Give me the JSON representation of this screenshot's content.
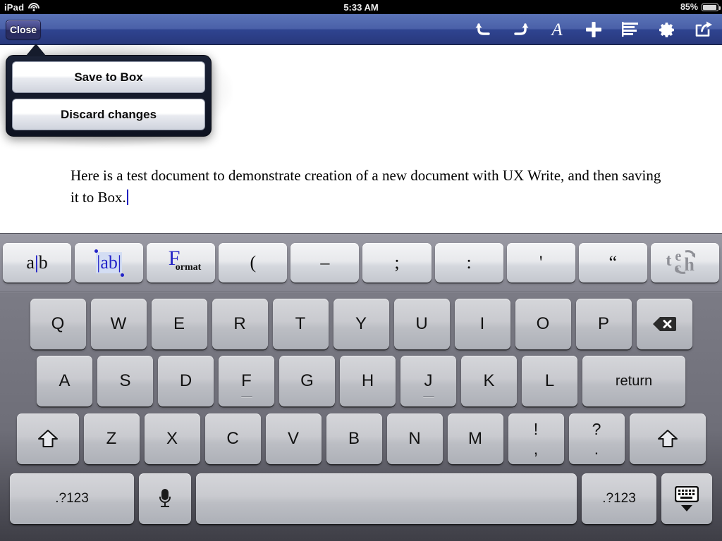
{
  "status_bar": {
    "device": "iPad",
    "wifi_icon": "wifi-icon",
    "time": "5:33 AM",
    "battery_percent": "85%",
    "battery_icon": "battery-icon"
  },
  "toolbar": {
    "close_label": "Close",
    "icons": [
      {
        "name": "undo-icon",
        "label": "Undo"
      },
      {
        "name": "redo-icon",
        "label": "Redo"
      },
      {
        "name": "text-style-icon",
        "label": "A"
      },
      {
        "name": "insert-plus-icon",
        "label": "Insert"
      },
      {
        "name": "outline-icon",
        "label": "Outline"
      },
      {
        "name": "settings-gear-icon",
        "label": "Settings"
      },
      {
        "name": "share-icon",
        "label": "Share"
      }
    ],
    "accent_color": "#3a4f9e"
  },
  "popover": {
    "items": [
      {
        "label": "Save to Box",
        "name": "save-to-box-button"
      },
      {
        "label": "Discard changes",
        "name": "discard-changes-button"
      }
    ]
  },
  "document": {
    "paragraph": "Here is a test document to demonstrate creation of a new document with UX Write, and then saving it to Box.",
    "caret_color": "#2020c0"
  },
  "keyboard": {
    "accessory_row": [
      {
        "name": "cursor-key",
        "type": "cursor",
        "pre": "a",
        "bar": "|",
        "post": "b"
      },
      {
        "name": "selection-key",
        "type": "select",
        "text": "ab"
      },
      {
        "name": "format-key",
        "type": "format",
        "initial": "F",
        "rest": "ormat"
      },
      {
        "name": "paren-key",
        "type": "punct",
        "label": "("
      },
      {
        "name": "dash-key",
        "type": "punct",
        "label": "–"
      },
      {
        "name": "semicolon-key",
        "type": "punct",
        "label": ";"
      },
      {
        "name": "colon-key",
        "type": "punct",
        "label": ":"
      },
      {
        "name": "apostrophe-key",
        "type": "punct",
        "label": "'"
      },
      {
        "name": "quote-key",
        "type": "punct",
        "label": "“"
      },
      {
        "name": "textexpander-key",
        "type": "tech",
        "label": "tech"
      }
    ],
    "row1": [
      "Q",
      "W",
      "E",
      "R",
      "T",
      "Y",
      "U",
      "I",
      "O",
      "P"
    ],
    "row1_extra": {
      "name": "delete-key",
      "label": "Backspace"
    },
    "row2": [
      "A",
      "S",
      "D",
      "F",
      "G",
      "H",
      "J",
      "K",
      "L"
    ],
    "row2_extra": {
      "name": "return-key",
      "label": "return"
    },
    "row3_shift_left": {
      "name": "shift-left-key",
      "label": "Shift"
    },
    "row3": [
      "Z",
      "X",
      "C",
      "V",
      "B",
      "N",
      "M"
    ],
    "row3_dual": [
      {
        "name": "exclam-comma-key",
        "top": "!",
        "bot": ","
      },
      {
        "name": "question-period-key",
        "top": "?",
        "bot": "."
      }
    ],
    "row3_shift_right": {
      "name": "shift-right-key",
      "label": "Shift"
    },
    "row4": {
      "numeric_left": ".?123",
      "dictation": {
        "name": "dictation-mic-key",
        "label": "Dictate"
      },
      "space": {
        "name": "space-key",
        "label": ""
      },
      "numeric_right": ".?123",
      "hide": {
        "name": "hide-keyboard-key",
        "label": "Hide Keyboard"
      }
    },
    "home_row_bump_keys": [
      "F",
      "J"
    ]
  }
}
